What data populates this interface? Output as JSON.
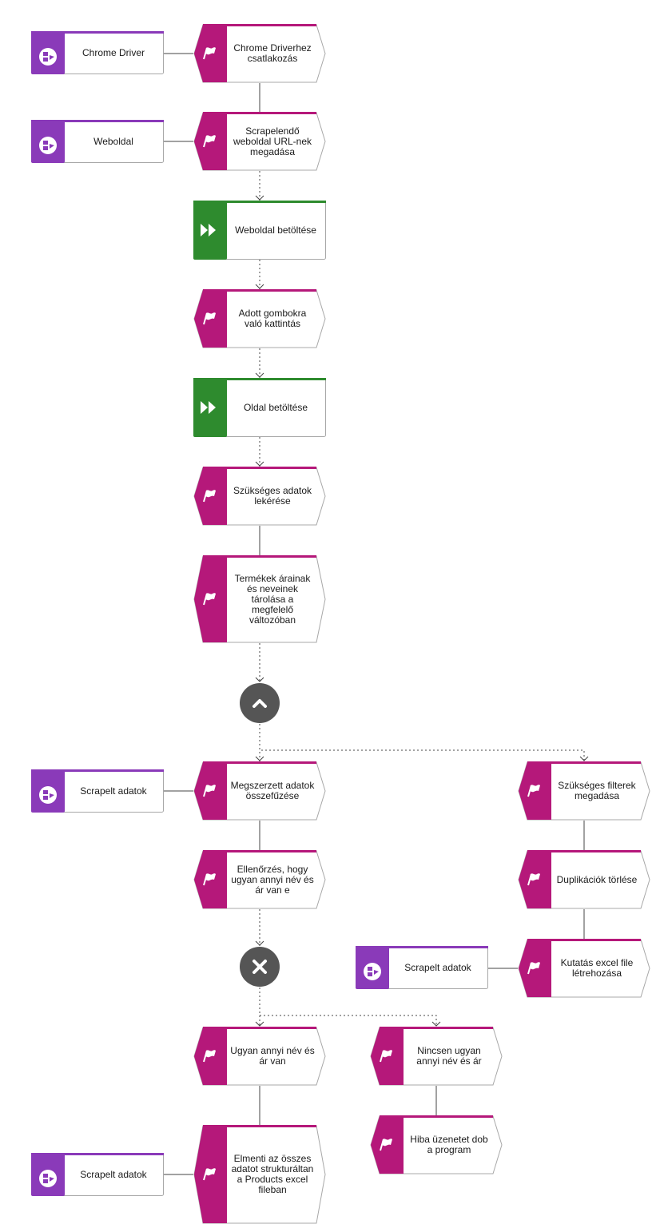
{
  "colors": {
    "function": "#b5187a",
    "event": "#2e8b2e",
    "system": "#8a3ab9",
    "gateway": "#555555",
    "border": "#a8a8a8",
    "line": "#444444"
  },
  "nodes": [
    {
      "id": "s1",
      "kind": "system",
      "icon": "application-system-icon",
      "label": "Chrome Driver"
    },
    {
      "id": "f1",
      "kind": "function",
      "icon": "flag-icon",
      "label": "Chrome Driverhez csatlakozás"
    },
    {
      "id": "s2",
      "kind": "system",
      "icon": "application-system-icon",
      "label": "Weboldal"
    },
    {
      "id": "f2",
      "kind": "function",
      "icon": "flag-icon",
      "label": "Scrapelendő weboldal URL-nek megadása"
    },
    {
      "id": "e1",
      "kind": "event",
      "icon": "fast-forward-icon",
      "label": "Weboldal betöltése"
    },
    {
      "id": "f3",
      "kind": "function",
      "icon": "flag-icon",
      "label": "Adott gombokra való kattintás"
    },
    {
      "id": "e2",
      "kind": "event",
      "icon": "fast-forward-icon",
      "label": "Oldal betöltése"
    },
    {
      "id": "f4",
      "kind": "function",
      "icon": "flag-icon",
      "label": "Szükséges adatok lekérése"
    },
    {
      "id": "f5",
      "kind": "function",
      "icon": "flag-icon",
      "label": "Termékek árainak és neveinek tárolása a megfelelő változóban"
    },
    {
      "id": "g1",
      "kind": "gateway-and",
      "icon": "chevron-up-icon",
      "label": ""
    },
    {
      "id": "s3",
      "kind": "system",
      "icon": "application-system-icon",
      "label": "Scrapelt adatok"
    },
    {
      "id": "f6",
      "kind": "function",
      "icon": "flag-icon",
      "label": "Megszerzett adatok összefűzése"
    },
    {
      "id": "f7",
      "kind": "function",
      "icon": "flag-icon",
      "label": "Szükséges filterek megadása"
    },
    {
      "id": "f8",
      "kind": "function",
      "icon": "flag-icon",
      "label": "Ellenőrzés, hogy ugyan annyi név és ár van e"
    },
    {
      "id": "f9",
      "kind": "function",
      "icon": "flag-icon",
      "label": "Duplikációk törlése"
    },
    {
      "id": "s4",
      "kind": "system",
      "icon": "application-system-icon",
      "label": "Scrapelt adatok"
    },
    {
      "id": "f10",
      "kind": "function",
      "icon": "flag-icon",
      "label": "Kutatás excel file létrehozása"
    },
    {
      "id": "g2",
      "kind": "gateway-xor",
      "icon": "close-icon",
      "label": ""
    },
    {
      "id": "f11",
      "kind": "function",
      "icon": "flag-icon",
      "label": "Ugyan annyi név és ár van"
    },
    {
      "id": "f12",
      "kind": "function",
      "icon": "flag-icon",
      "label": "Nincsen ugyan annyi név és ár"
    },
    {
      "id": "f13",
      "kind": "function",
      "icon": "flag-icon",
      "label": "Hiba üzenetet dob a program"
    },
    {
      "id": "s5",
      "kind": "system",
      "icon": "application-system-icon",
      "label": "Scrapelt adatok"
    },
    {
      "id": "f14",
      "kind": "function",
      "icon": "flag-icon",
      "label": "Elmenti az összes adatot strukturáltan a Products excel fileban"
    }
  ],
  "edges": [
    {
      "from": "s1",
      "to": "f1",
      "style": "solid"
    },
    {
      "from": "f1",
      "to": "f2",
      "style": "solid"
    },
    {
      "from": "s2",
      "to": "f2",
      "style": "solid"
    },
    {
      "from": "f2",
      "to": "e1",
      "style": "dotted"
    },
    {
      "from": "e1",
      "to": "f3",
      "style": "dotted"
    },
    {
      "from": "f3",
      "to": "e2",
      "style": "dotted"
    },
    {
      "from": "e2",
      "to": "f4",
      "style": "dotted"
    },
    {
      "from": "f4",
      "to": "f5",
      "style": "solid"
    },
    {
      "from": "f5",
      "to": "g1",
      "style": "dotted"
    },
    {
      "from": "g1",
      "to": "f6",
      "style": "dotted"
    },
    {
      "from": "g1",
      "to": "f7",
      "style": "dotted"
    },
    {
      "from": "s3",
      "to": "f6",
      "style": "solid"
    },
    {
      "from": "f6",
      "to": "f8",
      "style": "solid"
    },
    {
      "from": "f7",
      "to": "f9",
      "style": "solid"
    },
    {
      "from": "f9",
      "to": "f10",
      "style": "solid"
    },
    {
      "from": "s4",
      "to": "f10",
      "style": "solid"
    },
    {
      "from": "f8",
      "to": "g2",
      "style": "dotted"
    },
    {
      "from": "g2",
      "to": "f11",
      "style": "dotted"
    },
    {
      "from": "g2",
      "to": "f12",
      "style": "dotted"
    },
    {
      "from": "f11",
      "to": "f14",
      "style": "solid"
    },
    {
      "from": "f12",
      "to": "f13",
      "style": "solid"
    },
    {
      "from": "s5",
      "to": "f14",
      "style": "solid"
    }
  ]
}
